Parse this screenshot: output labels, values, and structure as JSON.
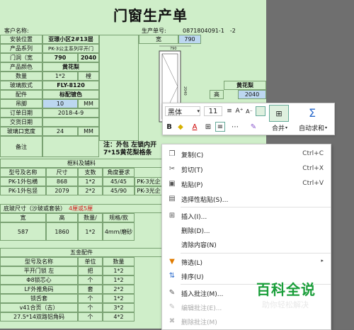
{
  "title": "门窗生产单",
  "header": {
    "customer_label": "客户名称:",
    "order_no_label": "生产单号:",
    "order_no_value": "0871804091-1　-2"
  },
  "info_rows": [
    {
      "label": "安装位置",
      "value": "亚璟小区2#13层"
    },
    {
      "label": "产品系列",
      "value": "PK-3公主系列平开门"
    },
    {
      "label": "门洞（宽",
      "v1": "790",
      "v2": "2040"
    },
    {
      "label": "产品颜色",
      "value": "黄花梨"
    },
    {
      "label": "数量",
      "v1": "1*2",
      "v2": "樘"
    },
    {
      "label": "玻璃款式",
      "value": "FLY-8120"
    },
    {
      "label": "配件",
      "value": "标配镀色"
    },
    {
      "label": "吊脚",
      "v1": "10",
      "v2": "MM"
    },
    {
      "label": "订单日期",
      "value": "2018-4-9"
    },
    {
      "label": "交货日期",
      "value": ""
    },
    {
      "label": "玻璃口宽度",
      "v1": "24",
      "v2": "MM"
    },
    {
      "label": "备注",
      "value": ""
    }
  ],
  "drawing": {
    "width_label": "宽",
    "width_value": "790",
    "dim_top": "790",
    "dim_side": "2040",
    "color_label": "黄花梨",
    "height_label": "高",
    "height_value": "2040"
  },
  "note_text": "注：外包 左锁内开 7*15黄花梨格条",
  "profile_section": {
    "title": "框料及辅料",
    "headers": [
      "型号及名称",
      "尺寸",
      "支数",
      "角度要求"
    ],
    "rows": [
      [
        "PK-1外包横",
        "868",
        "1*2",
        "45/45"
      ],
      [
        "PK-1外包竖",
        "2079",
        "2*2",
        "45/90"
      ]
    ],
    "right_codes": [
      "PK-3光企",
      "PK-3光企"
    ]
  },
  "glass_section": {
    "title": "底玻尺寸（沙玻或套装）",
    "title_note": "4厘或5厘",
    "headers": [
      "宽",
      "高",
      "数量/",
      "规格/款"
    ],
    "row": [
      "587",
      "1860",
      "1*2",
      "4mm/磨砂"
    ]
  },
  "hardware_section": {
    "title": "五金配件",
    "headers": [
      "型号及名称",
      "单位",
      "数量"
    ],
    "rows": [
      [
        "平开门锁 左",
        "把",
        "1*2"
      ],
      [
        "Φ8锁芯心",
        "个",
        "1*2"
      ],
      [
        "LF外推角码",
        "套",
        "2*2"
      ],
      [
        "锁舌套",
        "个",
        "1*2"
      ],
      [
        "v41合页（古）",
        "个",
        "3*2"
      ],
      [
        "27.5*14双路铝角码",
        "个",
        "4*2"
      ]
    ]
  },
  "float_toolbar": {
    "font_name": "黑体",
    "font_size": "11",
    "merge_label": "合并",
    "autosum_label": "自动求和",
    "grow_font": "A⁺",
    "shrink_font": "A⁻"
  },
  "context_menu": {
    "items": [
      {
        "label": "复制(C)",
        "shortcut": "Ctrl+C",
        "icon": "copy-icon",
        "glyph": "❐",
        "disabled": false
      },
      {
        "label": "剪切(T)",
        "shortcut": "Ctrl+X",
        "icon": "cut-icon",
        "glyph": "✂",
        "disabled": false
      },
      {
        "label": "粘贴(P)",
        "shortcut": "Ctrl+V",
        "icon": "paste-icon",
        "glyph": "📋",
        "disabled": false
      },
      {
        "label": "选择性粘贴(S)...",
        "shortcut": "",
        "icon": "paste-special-icon",
        "glyph": "▤",
        "disabled": false
      },
      {
        "label": "插入(I)...",
        "shortcut": "",
        "icon": "insert-icon",
        "glyph": "⊞",
        "disabled": false
      },
      {
        "label": "删除(D)...",
        "shortcut": "",
        "icon": "",
        "glyph": "",
        "disabled": false
      },
      {
        "label": "清除内容(N)",
        "shortcut": "",
        "icon": "",
        "glyph": "",
        "disabled": false
      },
      {
        "label": "筛选(L)",
        "shortcut": "",
        "icon": "filter-icon",
        "glyph": "⛉",
        "disabled": false
      },
      {
        "label": "排序(U)",
        "shortcut": "",
        "icon": "sort-icon",
        "glyph": "⇅",
        "disabled": false
      },
      {
        "label": "插入批注(M)...",
        "shortcut": "",
        "icon": "comment-icon",
        "glyph": "✎",
        "disabled": false
      },
      {
        "label": "编辑批注(E)...",
        "shortcut": "",
        "icon": "edit-comment-icon",
        "glyph": "✎",
        "disabled": true
      },
      {
        "label": "删除批注(M)",
        "shortcut": "",
        "icon": "delete-comment-icon",
        "glyph": "✖",
        "disabled": true
      }
    ]
  },
  "watermark": {
    "title": "百科全说",
    "subtitle": "助你轻松解决"
  },
  "colors": {
    "sheet_bg": "#cfeec9",
    "accent_red": "#d02020",
    "watermark_green": "#1a9e3a"
  }
}
